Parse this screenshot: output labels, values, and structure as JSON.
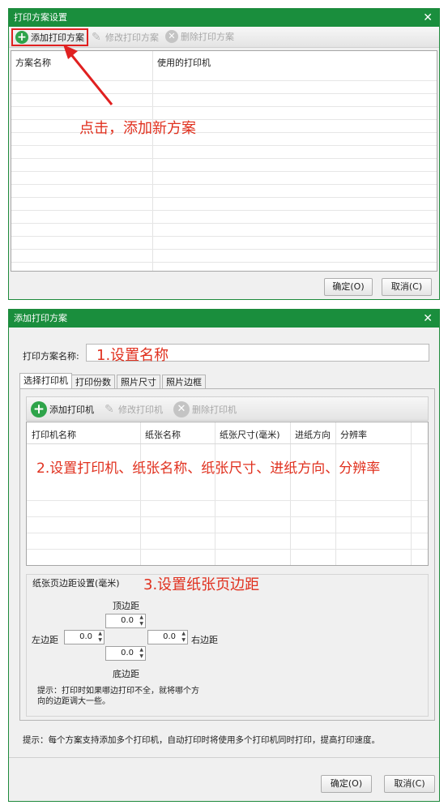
{
  "top": {
    "title": "打印方案设置",
    "toolbar": {
      "add": "添加打印方案",
      "edit": "修改打印方案",
      "delete": "删除打印方案"
    },
    "columns": [
      "方案名称",
      "使用的打印机"
    ],
    "annotation": "点击，添加新方案",
    "ok": "确定(O)",
    "cancel": "取消(C)"
  },
  "bottom": {
    "title": "添加打印方案",
    "name_label": "打印方案名称:",
    "name_annotation": "1.设置名称",
    "tabs": [
      "选择打印机",
      "打印份数",
      "照片尺寸",
      "照片边框"
    ],
    "toolbar": {
      "add": "添加打印机",
      "edit": "修改打印机",
      "delete": "删除打印机"
    },
    "columns": [
      "打印机名称",
      "纸张名称",
      "纸张尺寸(毫米)",
      "进纸方向",
      "分辨率"
    ],
    "grid_annotation": "2.设置打印机、纸张名称、纸张尺寸、进纸方向、分辨率",
    "margins": {
      "group_title": "纸张页边距设置(毫米)",
      "annotation": "3.设置纸张页边距",
      "top_label": "顶边距",
      "left_label": "左边距",
      "right_label": "右边距",
      "bottom_label": "底边距",
      "top_value": "0.0",
      "left_value": "0.0",
      "right_value": "0.0",
      "bottom_value": "0.0",
      "hint_line1": "提示：打印时如果哪边打印不全，就将哪个方",
      "hint_line2": "向的边距调大一些。"
    },
    "footer_hint": "提示：每个方案支持添加多个打印机，自动打印时将使用多个打印机同时打印，提高打印速度。",
    "ok": "确定(O)",
    "cancel": "取消(C)"
  },
  "colors": {
    "title_green": "#1a8e3d",
    "annotation_red": "#e0301e",
    "highlight_red": "#e02020"
  }
}
